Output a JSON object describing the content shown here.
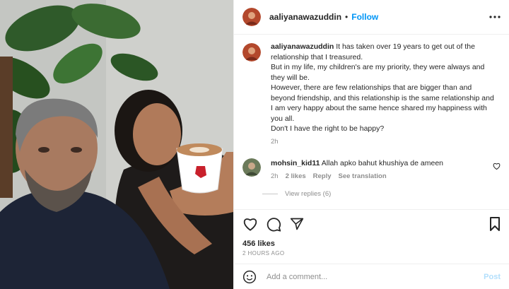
{
  "post": {
    "username": "aaliyanawazuddin",
    "follow_label": "Follow",
    "separator": "•"
  },
  "caption": {
    "username": "aaliyanawazuddin",
    "lines": [
      "It has taken over 19 years to get out of the relationship that I treasured.",
      "But in my life, my children's are my priority, they were always and they will be.",
      "However, there are few relationships that are bigger than and beyond friendship, and this relationship is the same relationship and I am very happy about the same hence shared my happiness with you all.",
      "Don't I have the right to be happy?"
    ],
    "time": "2h"
  },
  "comment": {
    "username": "mohsin_kid11",
    "text": "Allah apko bahut khushiya de ameen",
    "time": "2h",
    "likes": "2 likes",
    "reply_label": "Reply",
    "translation_label": "See translation",
    "view_replies": "View replies (6)"
  },
  "actions": {
    "likes": "456 likes",
    "posted": "2 HOURS AGO"
  },
  "add_comment": {
    "placeholder": "Add a comment...",
    "post_label": "Post"
  },
  "icons": {
    "more": "more-options-icon",
    "like": "heart-icon",
    "comment": "comment-icon",
    "share": "share-icon",
    "save": "bookmark-icon",
    "emoji": "emoji-icon"
  },
  "colors": {
    "accent": "#0095f6",
    "post_disabled": "#b2dffc",
    "secondary_text": "#8e8e8e"
  }
}
